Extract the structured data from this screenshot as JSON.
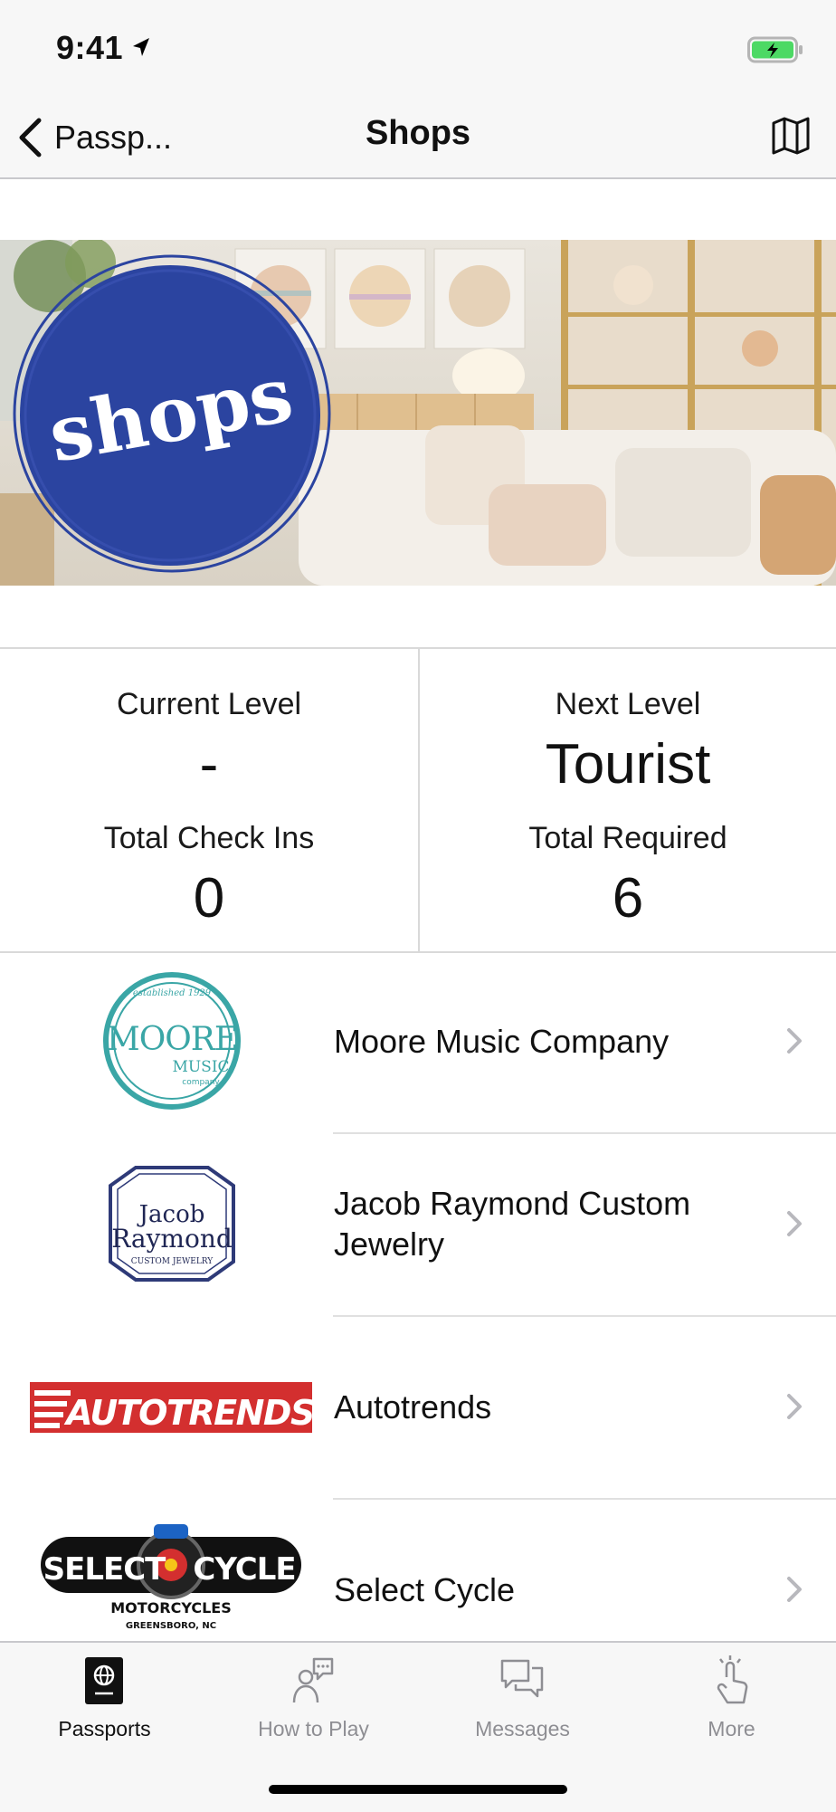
{
  "status_bar": {
    "time": "9:41"
  },
  "nav": {
    "back_label": "Passp...",
    "title": "Shops"
  },
  "banner": {
    "badge_text": "shops"
  },
  "stats": {
    "current_level_label": "Current Level",
    "current_level_value": "-",
    "check_ins_label": "Total Check Ins",
    "check_ins_value": "0",
    "next_level_label": "Next Level",
    "next_level_value": "Tourist",
    "required_label": "Total Required",
    "required_value": "6"
  },
  "shops": [
    {
      "name": "Moore Music Company",
      "logo": {
        "est": "established 1929",
        "word1": "MOORE",
        "word2": "MUSIC",
        "word3": "company"
      }
    },
    {
      "name": "Jacob Raymond Custom Jewelry",
      "logo": {
        "line1": "Jacob",
        "line2": "Raymond",
        "line3": "CUSTOM JEWELRY"
      }
    },
    {
      "name": "Autotrends",
      "logo": {
        "text": "AUTOTRENDS"
      }
    },
    {
      "name": "Select Cycle",
      "logo": {
        "left": "SELECT",
        "right": "CYCLE",
        "line2": "MOTORCYCLES",
        "line3": "GREENSBORO, NC"
      }
    }
  ],
  "tabs": [
    {
      "label": "Passports",
      "icon": "passport-icon",
      "active": true
    },
    {
      "label": "How to Play",
      "icon": "how-to-play-icon",
      "active": false
    },
    {
      "label": "Messages",
      "icon": "messages-icon",
      "active": false
    },
    {
      "label": "More",
      "icon": "more-icon",
      "active": false
    }
  ],
  "colors": {
    "badge_blue": "#2b44a0",
    "teal": "#3aa6a6",
    "autotrends_red": "#d32f2f",
    "jewelry_navy": "#2e3a78"
  }
}
